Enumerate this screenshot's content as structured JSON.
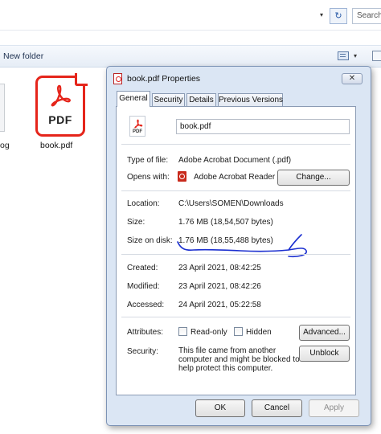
{
  "explorer": {
    "dropdown_glyph": "▾",
    "refresh_glyph": "↻",
    "search_placeholder": "Search",
    "toolbar": {
      "new_folder_label": "New folder",
      "view_dropdown_glyph": "▾"
    },
    "files": [
      {
        "label": "og",
        "icon": "file-icon"
      },
      {
        "label": "book.pdf",
        "icon": "pdf-file-icon",
        "icon_text": "PDF"
      }
    ]
  },
  "dialog": {
    "title": "book.pdf Properties",
    "close_glyph": "✕",
    "tabs": [
      {
        "label": "General",
        "active": true
      },
      {
        "label": "Security",
        "active": false
      },
      {
        "label": "Details",
        "active": false
      },
      {
        "label": "Previous Versions",
        "active": false
      }
    ],
    "file_icon_text": "PDF",
    "file_name": "book.pdf",
    "type_label": "Type of file:",
    "type_value": "Adobe Acrobat Document (.pdf)",
    "opens_label": "Opens with:",
    "opens_value": "Adobe Acrobat Reader",
    "change_button": "Change...",
    "location_label": "Location:",
    "location_value": "C:\\Users\\SOMEN\\Downloads",
    "size_label": "Size:",
    "size_value": "1.76 MB (18,54,507 bytes)",
    "size_on_disk_label": "Size on disk:",
    "size_on_disk_value": "1.76 MB (18,55,488 bytes)",
    "created_label": "Created:",
    "created_value": "23 April 2021, 08:42:25",
    "modified_label": "Modified:",
    "modified_value": "23 April 2021, 08:42:26",
    "accessed_label": "Accessed:",
    "accessed_value": "24 April 2021, 05:22:58",
    "attributes_label": "Attributes:",
    "readonly_label": "Read-only",
    "readonly_checked": false,
    "hidden_label": "Hidden",
    "hidden_checked": false,
    "advanced_button": "Advanced...",
    "security_label": "Security:",
    "security_lines": [
      "This file came from another",
      "computer and might be blocked to",
      "help protect this computer."
    ],
    "unblock_button": "Unblock",
    "ok_button": "OK",
    "cancel_button": "Cancel",
    "apply_button": "Apply",
    "apply_enabled": false,
    "annotation_color": "#1b2fd0",
    "pdf_red": "#e5251b"
  }
}
